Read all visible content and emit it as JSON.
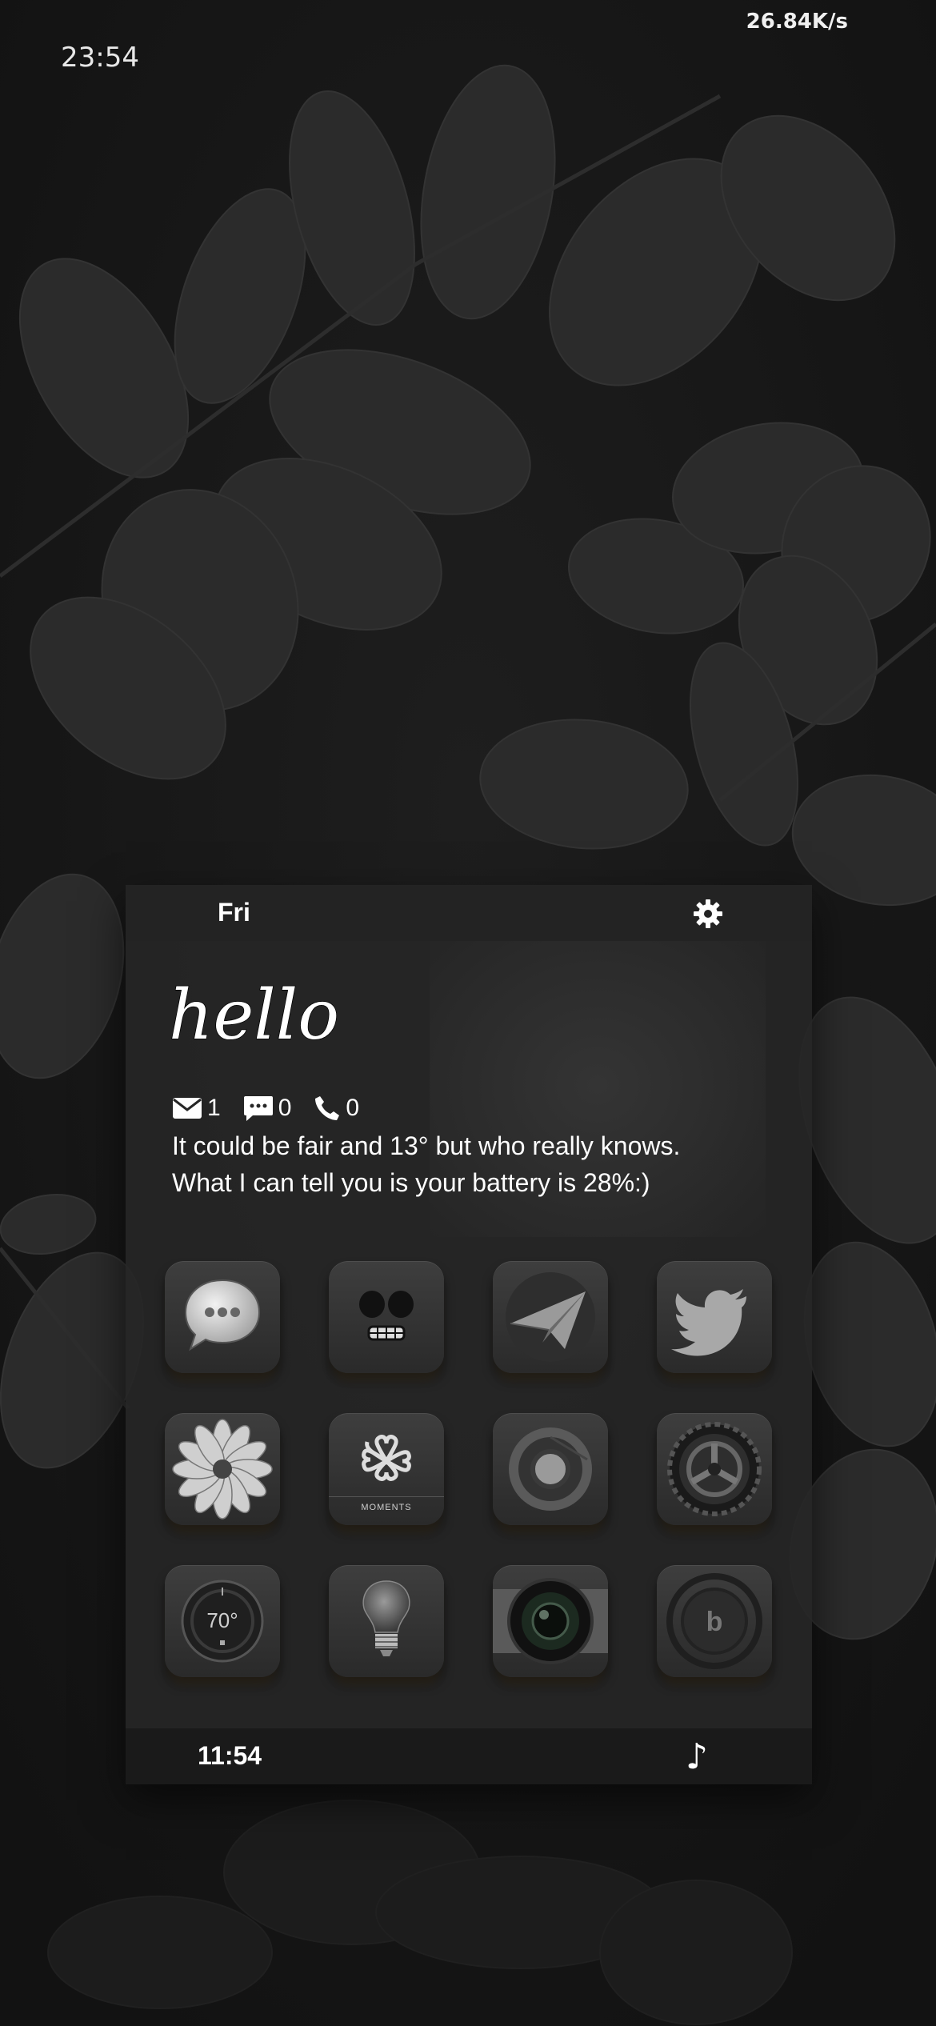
{
  "status_bar": {
    "time": "23:54",
    "network_speed": "26.84K/s"
  },
  "widget": {
    "day": "Fri",
    "settings_icon": "gear-icon",
    "greeting": "hello",
    "counters": {
      "mail": "1",
      "messages": "0",
      "calls": "0"
    },
    "message_line1": "It could be fair and 13° but who really knows.",
    "message_line2": "What I can tell you is your battery is 28%:)",
    "apps": [
      {
        "icon": "messages-icon"
      },
      {
        "icon": "face-app-icon"
      },
      {
        "icon": "paper-plane-icon"
      },
      {
        "icon": "twitter-bird-icon"
      },
      {
        "icon": "flower-icon"
      },
      {
        "icon": "moments-icon",
        "label": "MOMENTS"
      },
      {
        "icon": "chrome-icon"
      },
      {
        "icon": "settings-gear-icon"
      },
      {
        "icon": "thermostat-icon",
        "label": "70°"
      },
      {
        "icon": "lightbulb-icon"
      },
      {
        "icon": "camera-icon"
      },
      {
        "icon": "beats-headphones-icon"
      }
    ],
    "clock": "11:54",
    "music_icon": "music-note-icon",
    "music_glyph": "♪"
  },
  "colors": {
    "background": "#161616",
    "widget": "#262626",
    "text": "#ffffff",
    "icon_glow": "#b48c46"
  }
}
